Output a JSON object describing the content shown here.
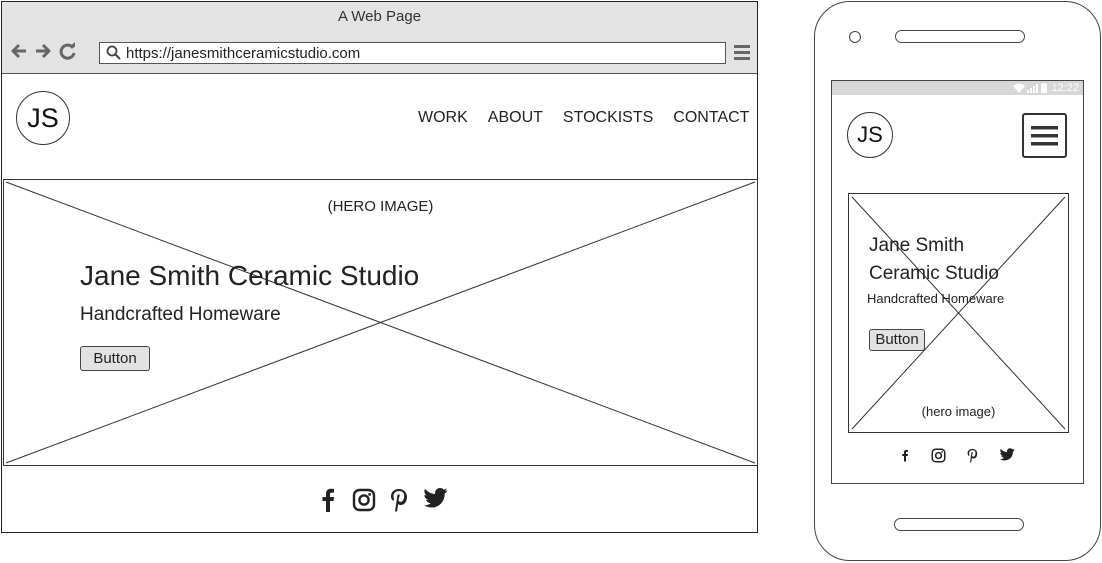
{
  "desktop": {
    "window_title": "A Web Page",
    "url": "https://janesmithceramicstudio.com",
    "logo_text": "JS",
    "nav": [
      "WORK",
      "ABOUT",
      "STOCKISTS",
      "CONTACT"
    ],
    "hero": {
      "caption": "(HERO IMAGE)",
      "title": "Jane Smith Ceramic Studio",
      "subtitle": "Handcrafted Homeware",
      "button_label": "Button"
    },
    "social_icons": [
      "facebook-icon",
      "instagram-icon",
      "pinterest-icon",
      "twitter-icon"
    ]
  },
  "mobile": {
    "status_time": "12:22",
    "logo_text": "JS",
    "hero": {
      "title_line1": "Jane Smith",
      "title_line2": "Ceramic Studio",
      "subtitle": "Handcrafted Homeware",
      "button_label": "Button",
      "caption": "(hero image)"
    },
    "social_icons": [
      "facebook-icon",
      "instagram-icon",
      "pinterest-icon",
      "twitter-icon"
    ]
  },
  "colors": {
    "chrome_bg": "#e3e3e3",
    "button_bg": "#e2e2e2",
    "status_bar": "#d7d7d7",
    "line": "#333333"
  }
}
